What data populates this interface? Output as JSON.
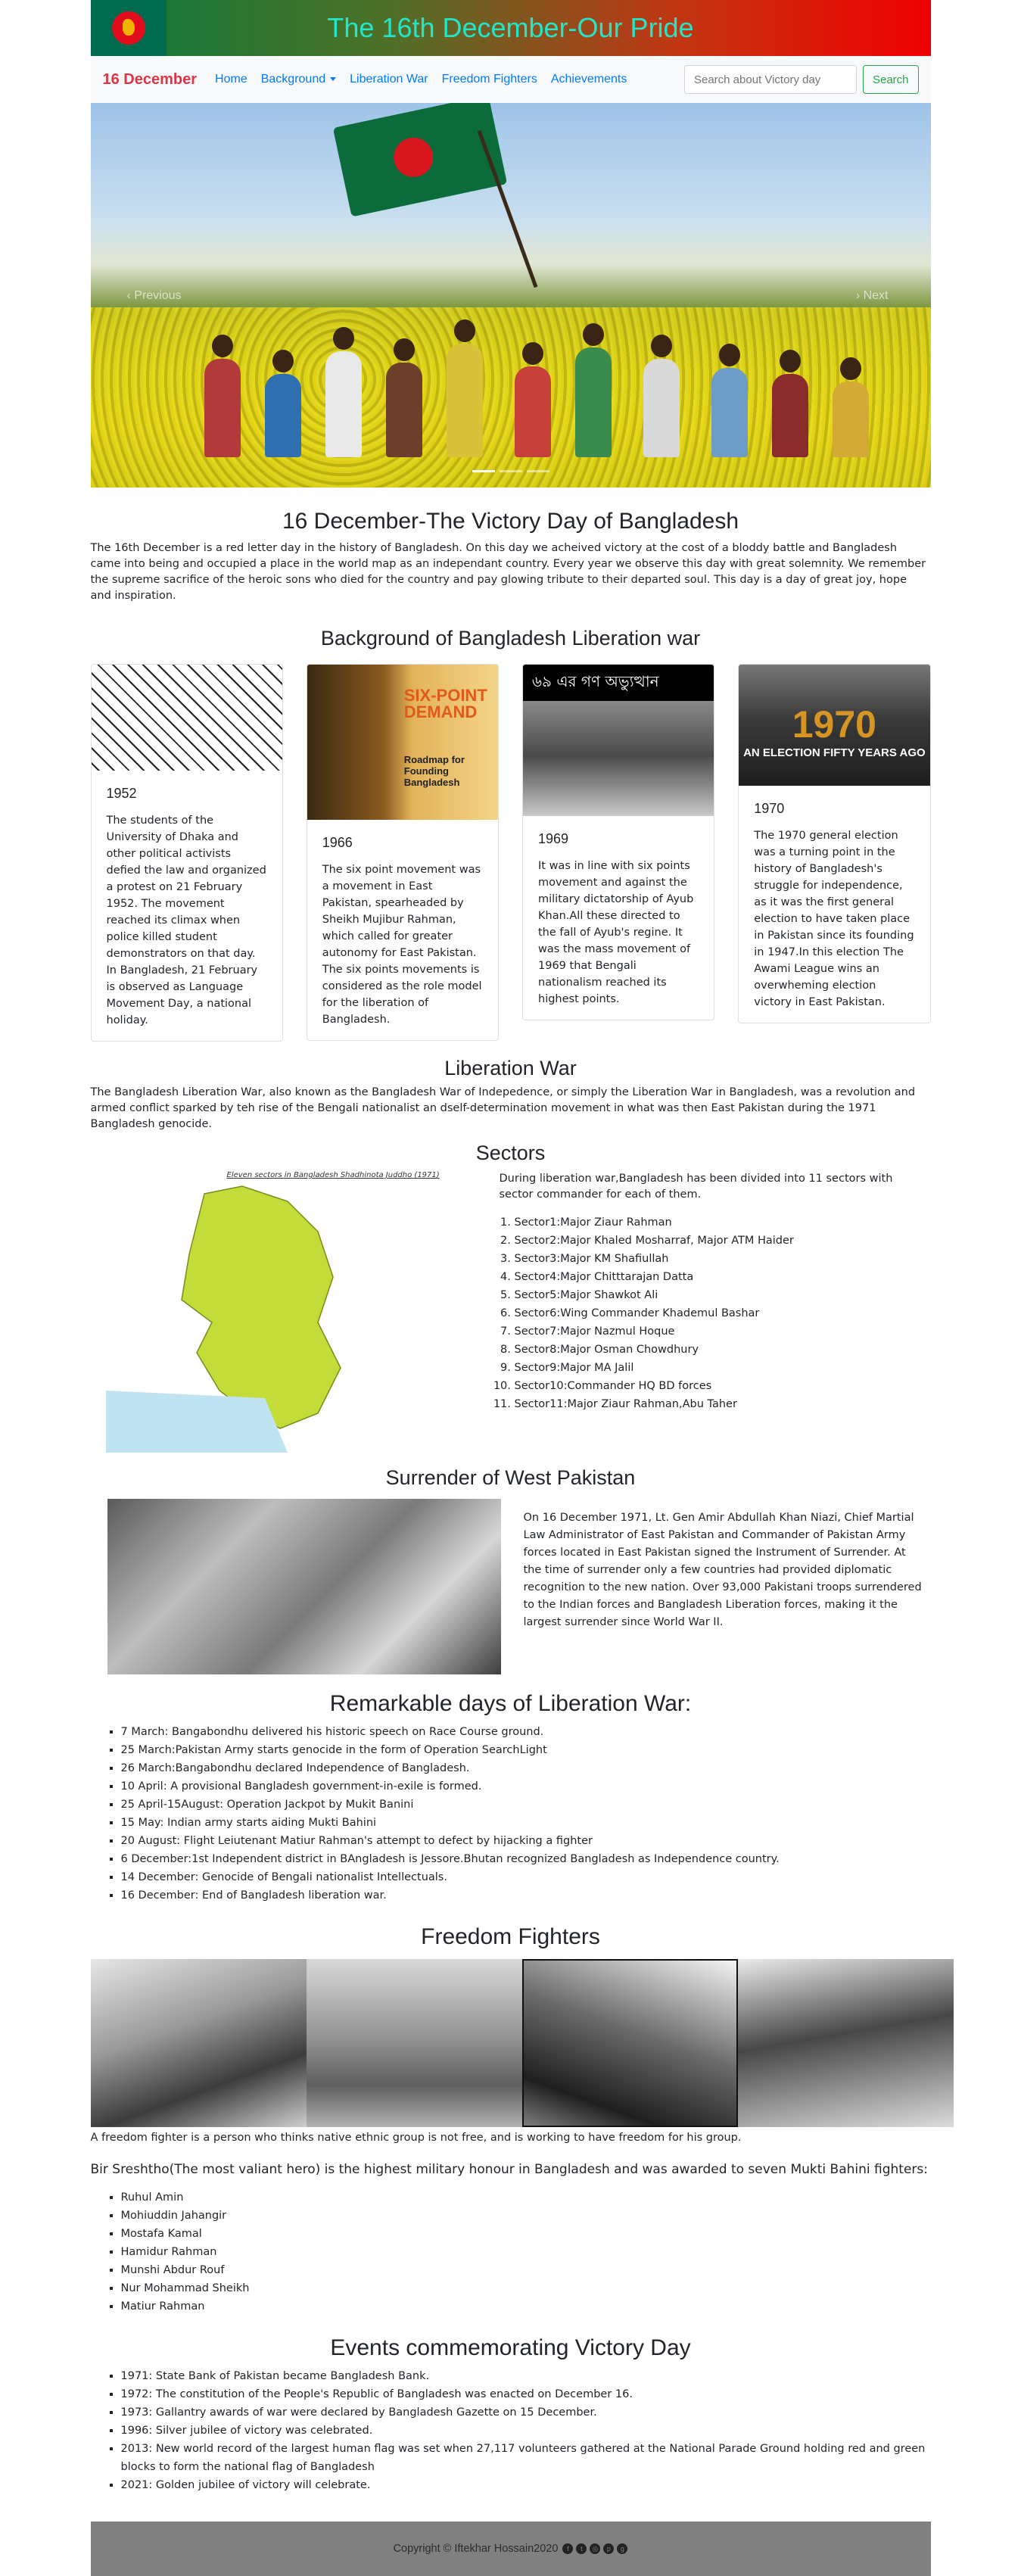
{
  "header": {
    "title": "The 16th December-Our Pride"
  },
  "navbar": {
    "brand": "16 December",
    "links": [
      "Home",
      "Background",
      "Liberation War",
      "Freedom Fighters",
      "Achievements"
    ],
    "search_placeholder": "Search about Victory day",
    "search_button": "Search"
  },
  "carousel": {
    "prev": "Previous",
    "next": "Next"
  },
  "intro": {
    "title": "16 December-The Victory Day of Bangladesh",
    "text": "The 16th December is a red letter day in the history of Bangladesh. On this day we acheived victory at the cost of a bloddy battle and Bangladesh came into being and occupied a place in the world map as an independant country. Every year we observe this day with great solemnity. We remember the supreme sacrifice of the heroic sons who died for the country and pay glowing tribute to their departed soul. This day is a day of great joy, hope and inspiration."
  },
  "background": {
    "title": "Background of Bangladesh Liberation war",
    "cards": [
      {
        "year": "1952",
        "text": "The students of the University of Dhaka and other political activists defied the law and organized a protest on 21 February 1952. The movement reached its climax when police killed student demonstrators on that day. In Bangladesh, 21 February is observed as Language Movement Day, a national holiday."
      },
      {
        "year": "1966",
        "text": "The six point movement was a movement in East Pakistan, spearheaded by Sheikh Mujibur Rahman, which called for greater autonomy for East Pakistan. The six points movements is considered as the role model for the liberation of Bangladesh.",
        "img_title": "SIX-POINT DEMAND",
        "img_subtitle": "Roadmap for Founding Bangladesh"
      },
      {
        "year": "1969",
        "text": "It was in line with six points movement and against the military dictatorship of Ayub Khan.All these directed to the fall of Ayub's regine. It was the mass movement of 1969 that Bengali nationalism reached its highest points.",
        "img_title": "৬৯ এর গণ অভ্যুত্থান"
      },
      {
        "year": "1970",
        "text": "The 1970 general election was a turning point in the history of Bangladesh's struggle for independence, as it was the first general election to have taken place in Pakistan since its founding in 1947.In this election The Awami League wins an overwheming election victory in East Pakistan.",
        "img_title": "1970",
        "img_subtitle": "AN ELECTION FIFTY YEARS AGO"
      }
    ]
  },
  "liberation": {
    "title": "Liberation War",
    "text": "The Bangladesh Liberation War, also known as the Bangladesh War of Indepedence, or simply the Liberation War in Bangladesh, was a revolution and armed conflict sparked by teh rise of the Bengali nationalist an dself-determination movement in what was then East Pakistan during the 1971 Bangladesh genocide."
  },
  "sectors": {
    "title": "Sectors",
    "intro": "During liberation war,Bangladesh has been divided into 11 sectors with sector commander for each of them.",
    "map_title": "Eleven sectors in Bangladesh Shadhinota Juddho (1971)",
    "items": [
      "Sector1:Major Ziaur Rahman",
      "Sector2:Major Khaled Mosharraf, Major ATM Haider",
      "Sector3:Major KM Shafiullah",
      "Sector4:Major Chitttarajan Datta",
      "Sector5:Major Shawkot Ali",
      "Sector6:Wing Commander Khademul Bashar",
      "Sector7:Major Nazmul Hoque",
      "Sector8:Major Osman Chowdhury",
      "Sector9:Major MA Jalil",
      "Sector10:Commander HQ BD forces",
      "Sector11:Major Ziaur Rahman,Abu Taher"
    ]
  },
  "surrender": {
    "title": "Surrender of West Pakistan",
    "text": "On 16 December 1971, Lt. Gen Amir Abdullah Khan Niazi, Chief Martial Law Administrator of East Pakistan and Commander of Pakistan Army forces located in East Pakistan signed the Instrument of Surrender. At the time of surrender only a few countries had provided diplomatic recognition to the new nation. Over 93,000 Pakistani troops surrendered to the Indian forces and Bangladesh Liberation forces, making it the largest surrender since World War II."
  },
  "remarkable": {
    "title": "Remarkable days of Liberation War:",
    "items": [
      "7 March: Bangabondhu delivered his historic speech on Race Course ground.",
      "25 March:Pakistan Army starts genocide in the form of Operation SearchLight",
      "26 March:Bangabondhu declared Independence of Bangladesh.",
      "10 April: A provisional Bangladesh government-in-exile is formed.",
      "25 April-15August: Operation Jackpot by Mukit Banini",
      "15 May: Indian army starts aiding Mukti Bahini",
      "20 August: Flight Leiutenant Matiur Rahman's attempt to defect by hijacking a fighter",
      "6 December:1st Independent district in BAngladesh is Jessore.Bhutan recognized Bangladesh as Independence country.",
      "14 December: Genocide of Bengali nationalist Intellectuals.",
      "16 December: End of Bangladesh liberation war."
    ]
  },
  "fighters": {
    "title": "Freedom Fighters",
    "text": "A freedom fighter is a person who thinks native ethnic group is not free, and is working to have freedom for his group.",
    "honour": "Bir Sreshtho(The most valiant hero) is the highest military honour in Bangladesh and was awarded to seven Mukti Bahini fighters:",
    "heroes": [
      "Ruhul Amin",
      "Mohiuddin Jahangir",
      "Mostafa Kamal",
      "Hamidur Rahman",
      "Munshi Abdur Rouf",
      "Nur Mohammad Sheikh",
      "Matiur Rahman"
    ]
  },
  "events": {
    "title": "Events commemorating Victory Day",
    "items": [
      "1971: State Bank of Pakistan became Bangladesh Bank.",
      "1972: The constitution of the People's Republic of Bangladesh was enacted on December 16.",
      "1973: Gallantry awards of war were declared by Bangladesh Gazette on 15 December.",
      "1996: Silver jubilee of victory was celebrated.",
      "2013: New world record of the largest human flag was set when 27,117 volunteers gathered at the National Parade Ground holding red and green blocks to form the national flag of Bangladesh",
      "2021: Golden jubilee of victory will celebrate."
    ]
  },
  "footer": {
    "text": "Copyright © Iftekhar Hossain2020"
  }
}
